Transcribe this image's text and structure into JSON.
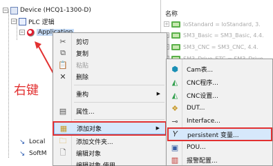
{
  "tree": {
    "device": "Device (HCQ1-1300-D)",
    "plc": "PLC 逻辑",
    "application": "Application",
    "local": "Local",
    "softmotion": "SoftM",
    "annotation": "右键"
  },
  "right_pane": {
    "header": "名称",
    "rows": [
      "IoStandard = IoStandard, 3.",
      "SM3_Basic = SM3_Basic, 4.4.",
      "SM3_CNC = SM3_CNC, 4.4.",
      "SM3_Drive_ETC = SM3_Drive"
    ]
  },
  "context_menu": {
    "items": [
      {
        "label": "剪切",
        "icon": "scissors-icon",
        "disabled": false
      },
      {
        "label": "复制",
        "icon": "copy-icon",
        "disabled": false
      },
      {
        "label": "粘贴",
        "icon": "paste-icon",
        "disabled": true
      },
      {
        "label": "删除",
        "icon": "delete-icon",
        "disabled": false
      },
      {
        "label": "重构",
        "icon": "",
        "disabled": false,
        "submenu": true
      },
      {
        "label": "属性...",
        "icon": "properties-icon",
        "disabled": false
      },
      {
        "label": "添加对象",
        "icon": "add-object-icon",
        "disabled": false,
        "submenu": true,
        "highlighted": true
      },
      {
        "label": "添加文件夹...",
        "icon": "folder-icon",
        "disabled": false
      },
      {
        "label": "编辑对象",
        "icon": "edit-icon",
        "disabled": false
      },
      {
        "label": "编辑对象,使用...",
        "icon": "",
        "disabled": false
      }
    ]
  },
  "submenu": {
    "items": [
      {
        "label": "Cam表...",
        "icon": "cam-table-icon"
      },
      {
        "label": "CNC程序...",
        "icon": "cnc-program-icon"
      },
      {
        "label": "CNC设置...",
        "icon": "cnc-settings-icon"
      },
      {
        "label": "DUT...",
        "icon": "dut-icon"
      },
      {
        "label": "Interface...",
        "icon": "interface-icon"
      },
      {
        "label": "persistent 变量...",
        "icon": "persistent-var-icon",
        "highlighted": true
      },
      {
        "label": "POU...",
        "icon": "pou-icon"
      },
      {
        "label": "报警配置...",
        "icon": "alarm-config-icon"
      }
    ]
  },
  "colors": {
    "highlight_bg": "#d6e8fb",
    "annotation_red": "#e23030",
    "cnc_green": "#2e9e4a",
    "cam_teal": "#1a8fb5"
  }
}
